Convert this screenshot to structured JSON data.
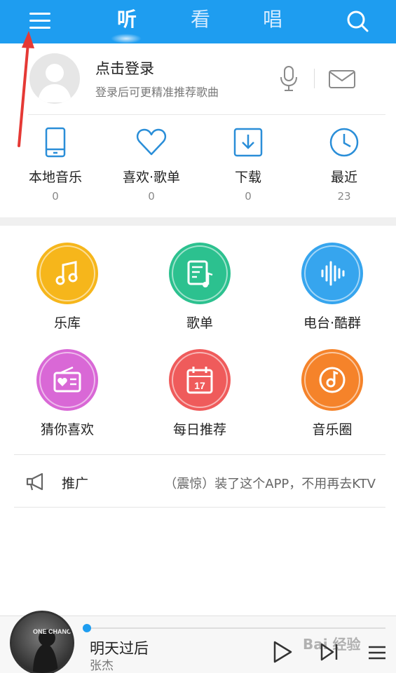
{
  "header": {
    "tabs": [
      "听",
      "看",
      "唱"
    ],
    "active_tab": "听",
    "accent_color": "#1e9df0"
  },
  "login": {
    "title": "点击登录",
    "subtitle": "登录后可更精准推荐歌曲"
  },
  "quick": [
    {
      "label": "本地音乐",
      "count": "0",
      "icon": "phone-icon"
    },
    {
      "label": "喜欢·歌单",
      "count": "0",
      "icon": "heart-icon"
    },
    {
      "label": "下载",
      "count": "0",
      "icon": "download-icon"
    },
    {
      "label": "最近",
      "count": "23",
      "icon": "clock-icon"
    }
  ],
  "grid": [
    {
      "label": "乐库",
      "color": "#f6b61b",
      "icon": "music-note-icon"
    },
    {
      "label": "歌单",
      "color": "#2cc18f",
      "icon": "songlist-icon"
    },
    {
      "label": "电台·酷群",
      "color": "#36a5ee",
      "icon": "soundwave-icon"
    },
    {
      "label": "猜你喜欢",
      "color": "#d968d6",
      "icon": "radio-icon"
    },
    {
      "label": "每日推荐",
      "color": "#ef5b5b",
      "icon": "calendar-icon",
      "day": "17"
    },
    {
      "label": "音乐圈",
      "color": "#f5832a",
      "icon": "music-circle-icon"
    }
  ],
  "promo": {
    "tag": "推广",
    "text": "（震惊）装了这个APP，不用再去KTV"
  },
  "player": {
    "song": "明天过后",
    "artist": "张杰",
    "cover_text": "ONE CHANCE",
    "progress": 0,
    "watermark": "Bai 经验"
  }
}
